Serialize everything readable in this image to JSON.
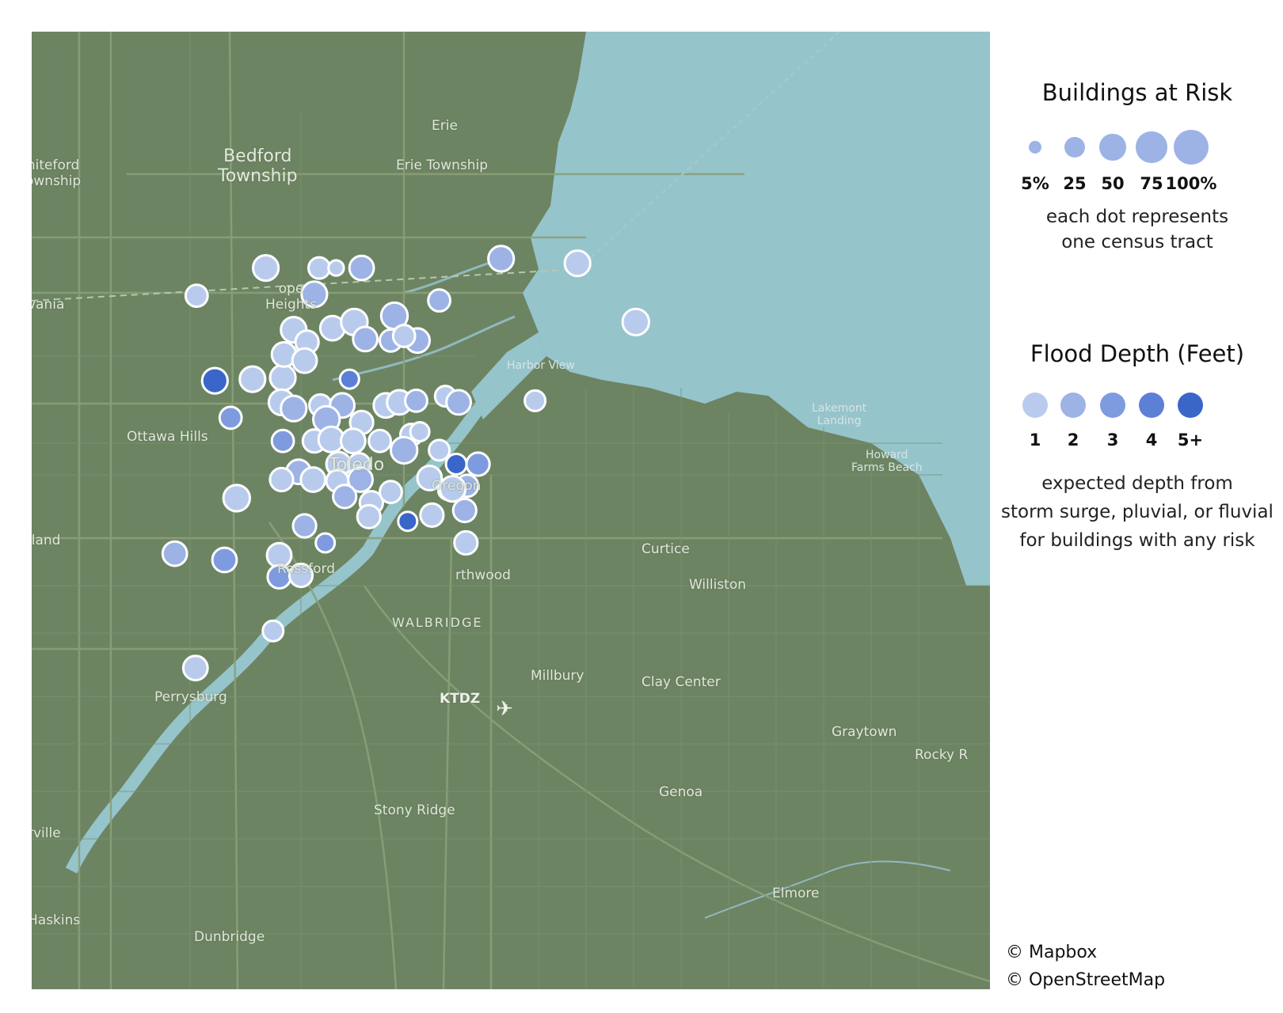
{
  "map": {
    "place_labels": [
      {
        "name": "label-erie",
        "text": "Erie"
      },
      {
        "name": "label-whiteford",
        "text": "hiteford\nownship"
      },
      {
        "name": "label-bedford",
        "text": "Bedford\nTownship"
      },
      {
        "name": "label-erie-township",
        "text": "Erie Township"
      },
      {
        "name": "label-sylvania",
        "text": "vania"
      },
      {
        "name": "label-lambertville",
        "text": "ope\nHeights"
      },
      {
        "name": "label-harbor-view",
        "text": "Harbor View"
      },
      {
        "name": "label-ottawa-hills",
        "text": "Ottawa Hills"
      },
      {
        "name": "label-toledo",
        "text": "Toledo"
      },
      {
        "name": "label-oregon",
        "text": "Oregon"
      },
      {
        "name": "label-lakemont",
        "text": "Lakemont\nLanding"
      },
      {
        "name": "label-howard-farms",
        "text": "Howard\nFarms Beach"
      },
      {
        "name": "label-holland",
        "text": "lland"
      },
      {
        "name": "label-rossford",
        "text": "Rossford"
      },
      {
        "name": "label-northwood",
        "text": "rthwood"
      },
      {
        "name": "label-curtice",
        "text": "Curtice"
      },
      {
        "name": "label-williston",
        "text": "Williston"
      },
      {
        "name": "label-walbridge",
        "text": "WALBRIDGE"
      },
      {
        "name": "label-millbury",
        "text": "Millbury"
      },
      {
        "name": "label-clay-center",
        "text": "Clay Center"
      },
      {
        "name": "label-ktdz",
        "text": "KTDZ"
      },
      {
        "name": "label-perrysburg",
        "text": "Perrysburg"
      },
      {
        "name": "label-graytown",
        "text": "Graytown"
      },
      {
        "name": "label-rocky-ridge",
        "text": "Rocky R"
      },
      {
        "name": "label-genoa",
        "text": "Genoa"
      },
      {
        "name": "label-stony-ridge",
        "text": "Stony Ridge"
      },
      {
        "name": "label-waterville",
        "text": "rville"
      },
      {
        "name": "label-elmore",
        "text": "Elmore"
      },
      {
        "name": "label-haskins",
        "text": "Haskins"
      },
      {
        "name": "label-dunbridge",
        "text": "Dunbridge"
      }
    ],
    "depth_colors": [
      "#b9cbed",
      "#9db3e6",
      "#7f9be0",
      "#5b80d6",
      "#3a66c9"
    ],
    "tracts": [
      {
        "lon": -83.724,
        "lat": 41.714,
        "risk": 30,
        "depth": 1
      },
      {
        "lon": -83.667,
        "lat": 41.732,
        "risk": 45,
        "depth": 1
      },
      {
        "lon": -83.623,
        "lat": 41.732,
        "risk": 28,
        "depth": 1
      },
      {
        "lon": -83.609,
        "lat": 41.732,
        "risk": 10,
        "depth": 1
      },
      {
        "lon": -83.588,
        "lat": 41.732,
        "risk": 40,
        "depth": 2
      },
      {
        "lon": -83.627,
        "lat": 41.715,
        "risk": 45,
        "depth": 2
      },
      {
        "lon": -83.644,
        "lat": 41.692,
        "risk": 45,
        "depth": 1
      },
      {
        "lon": -83.633,
        "lat": 41.684,
        "risk": 35,
        "depth": 1
      },
      {
        "lon": -83.612,
        "lat": 41.693,
        "risk": 40,
        "depth": 1
      },
      {
        "lon": -83.594,
        "lat": 41.697,
        "risk": 50,
        "depth": 1
      },
      {
        "lon": -83.585,
        "lat": 41.686,
        "risk": 40,
        "depth": 2
      },
      {
        "lon": -83.564,
        "lat": 41.685,
        "risk": 30,
        "depth": 2
      },
      {
        "lon": -83.542,
        "lat": 41.685,
        "risk": 40,
        "depth": 2
      },
      {
        "lon": -83.561,
        "lat": 41.701,
        "risk": 50,
        "depth": 2
      },
      {
        "lon": -83.553,
        "lat": 41.688,
        "risk": 30,
        "depth": 1
      },
      {
        "lon": -83.524,
        "lat": 41.711,
        "risk": 30,
        "depth": 2
      },
      {
        "lon": -83.473,
        "lat": 41.738,
        "risk": 45,
        "depth": 2
      },
      {
        "lon": -83.709,
        "lat": 41.659,
        "risk": 45,
        "depth": 5
      },
      {
        "lon": -83.678,
        "lat": 41.66,
        "risk": 45,
        "depth": 1
      },
      {
        "lon": -83.653,
        "lat": 41.661,
        "risk": 45,
        "depth": 1
      },
      {
        "lon": -83.652,
        "lat": 41.676,
        "risk": 40,
        "depth": 1
      },
      {
        "lon": -83.635,
        "lat": 41.672,
        "risk": 40,
        "depth": 1
      },
      {
        "lon": -83.598,
        "lat": 41.66,
        "risk": 20,
        "depth": 4
      },
      {
        "lon": -83.696,
        "lat": 41.635,
        "risk": 30,
        "depth": 3
      },
      {
        "lon": -83.654,
        "lat": 41.645,
        "risk": 45,
        "depth": 1
      },
      {
        "lon": -83.644,
        "lat": 41.641,
        "risk": 45,
        "depth": 2
      },
      {
        "lon": -83.622,
        "lat": 41.643,
        "risk": 30,
        "depth": 1
      },
      {
        "lon": -83.604,
        "lat": 41.643,
        "risk": 40,
        "depth": 2
      },
      {
        "lon": -83.617,
        "lat": 41.634,
        "risk": 50,
        "depth": 2
      },
      {
        "lon": -83.588,
        "lat": 41.632,
        "risk": 35,
        "depth": 1
      },
      {
        "lon": -83.568,
        "lat": 41.643,
        "risk": 40,
        "depth": 1
      },
      {
        "lon": -83.557,
        "lat": 41.645,
        "risk": 40,
        "depth": 1
      },
      {
        "lon": -83.543,
        "lat": 41.646,
        "risk": 30,
        "depth": 2
      },
      {
        "lon": -83.547,
        "lat": 41.624,
        "risk": 30,
        "depth": 1
      },
      {
        "lon": -83.519,
        "lat": 41.649,
        "risk": 25,
        "depth": 1
      },
      {
        "lon": -83.508,
        "lat": 41.645,
        "risk": 40,
        "depth": 2
      },
      {
        "lon": -83.445,
        "lat": 41.646,
        "risk": 25,
        "depth": 1
      },
      {
        "lon": -83.653,
        "lat": 41.62,
        "risk": 30,
        "depth": 3
      },
      {
        "lon": -83.627,
        "lat": 41.62,
        "risk": 35,
        "depth": 1
      },
      {
        "lon": -83.613,
        "lat": 41.621,
        "risk": 45,
        "depth": 1
      },
      {
        "lon": -83.595,
        "lat": 41.62,
        "risk": 40,
        "depth": 1
      },
      {
        "lon": -83.573,
        "lat": 41.62,
        "risk": 30,
        "depth": 1
      },
      {
        "lon": -83.553,
        "lat": 41.614,
        "risk": 50,
        "depth": 2
      },
      {
        "lon": -83.54,
        "lat": 41.626,
        "risk": 20,
        "depth": 1
      },
      {
        "lon": -83.524,
        "lat": 41.614,
        "risk": 25,
        "depth": 1
      },
      {
        "lon": -83.51,
        "lat": 41.605,
        "risk": 25,
        "depth": 5
      },
      {
        "lon": -83.492,
        "lat": 41.605,
        "risk": 35,
        "depth": 3
      },
      {
        "lon": -83.64,
        "lat": 41.6,
        "risk": 40,
        "depth": 2
      },
      {
        "lon": -83.654,
        "lat": 41.595,
        "risk": 35,
        "depth": 1
      },
      {
        "lon": -83.628,
        "lat": 41.595,
        "risk": 40,
        "depth": 1
      },
      {
        "lon": -83.607,
        "lat": 41.605,
        "risk": 40,
        "depth": 1
      },
      {
        "lon": -83.608,
        "lat": 41.594,
        "risk": 30,
        "depth": 1
      },
      {
        "lon": -83.59,
        "lat": 41.605,
        "risk": 30,
        "depth": 1
      },
      {
        "lon": -83.589,
        "lat": 41.595,
        "risk": 40,
        "depth": 2
      },
      {
        "lon": -83.532,
        "lat": 41.596,
        "risk": 40,
        "depth": 1
      },
      {
        "lon": -83.517,
        "lat": 41.588,
        "risk": 20,
        "depth": 1
      },
      {
        "lon": -83.501,
        "lat": 41.591,
        "risk": 30,
        "depth": 2
      },
      {
        "lon": -83.513,
        "lat": 41.589,
        "risk": 45,
        "depth": 1
      },
      {
        "lon": -83.602,
        "lat": 41.584,
        "risk": 35,
        "depth": 2
      },
      {
        "lon": -83.58,
        "lat": 41.58,
        "risk": 35,
        "depth": 1
      },
      {
        "lon": -83.564,
        "lat": 41.587,
        "risk": 30,
        "depth": 1
      },
      {
        "lon": -83.582,
        "lat": 41.571,
        "risk": 35,
        "depth": 1
      },
      {
        "lon": -83.55,
        "lat": 41.568,
        "risk": 20,
        "depth": 5
      },
      {
        "lon": -83.53,
        "lat": 41.572,
        "risk": 35,
        "depth": 1
      },
      {
        "lon": -83.503,
        "lat": 41.575,
        "risk": 35,
        "depth": 2
      },
      {
        "lon": -83.691,
        "lat": 41.583,
        "risk": 50,
        "depth": 1
      },
      {
        "lon": -83.635,
        "lat": 41.565,
        "risk": 35,
        "depth": 2
      },
      {
        "lon": -83.618,
        "lat": 41.554,
        "risk": 20,
        "depth": 3
      },
      {
        "lon": -83.502,
        "lat": 41.554,
        "risk": 35,
        "depth": 1
      },
      {
        "lon": -83.742,
        "lat": 41.547,
        "risk": 40,
        "depth": 2
      },
      {
        "lon": -83.701,
        "lat": 41.543,
        "risk": 40,
        "depth": 3
      },
      {
        "lon": -83.656,
        "lat": 41.546,
        "risk": 40,
        "depth": 1
      },
      {
        "lon": -83.656,
        "lat": 41.532,
        "risk": 35,
        "depth": 3
      },
      {
        "lon": -83.638,
        "lat": 41.533,
        "risk": 35,
        "depth": 1
      },
      {
        "lon": -83.661,
        "lat": 41.497,
        "risk": 25,
        "depth": 1
      },
      {
        "lon": -83.725,
        "lat": 41.473,
        "risk": 40,
        "depth": 1
      },
      {
        "lon": -83.362,
        "lat": 41.697,
        "risk": 50,
        "depth": 1
      },
      {
        "lon": -83.41,
        "lat": 41.735,
        "risk": 45,
        "depth": 1
      }
    ]
  },
  "legend": {
    "size_title": "Buildings at Risk",
    "size_labels": [
      "5%",
      "25",
      "50",
      "75",
      "100%"
    ],
    "size_values": [
      5,
      25,
      50,
      75,
      100
    ],
    "size_note_line1": "each dot represents",
    "size_note_line2": "one census tract",
    "depth_title": "Flood Depth (Feet)",
    "depth_labels": [
      "1",
      "2",
      "3",
      "4",
      "5+"
    ],
    "depth_note_line1": "expected depth from",
    "depth_note_line2": "storm surge, pluvial, or fluvial",
    "depth_note_line3": "for buildings with any risk"
  },
  "credits": {
    "mapbox": "© Mapbox",
    "osm": "© OpenStreetMap"
  }
}
